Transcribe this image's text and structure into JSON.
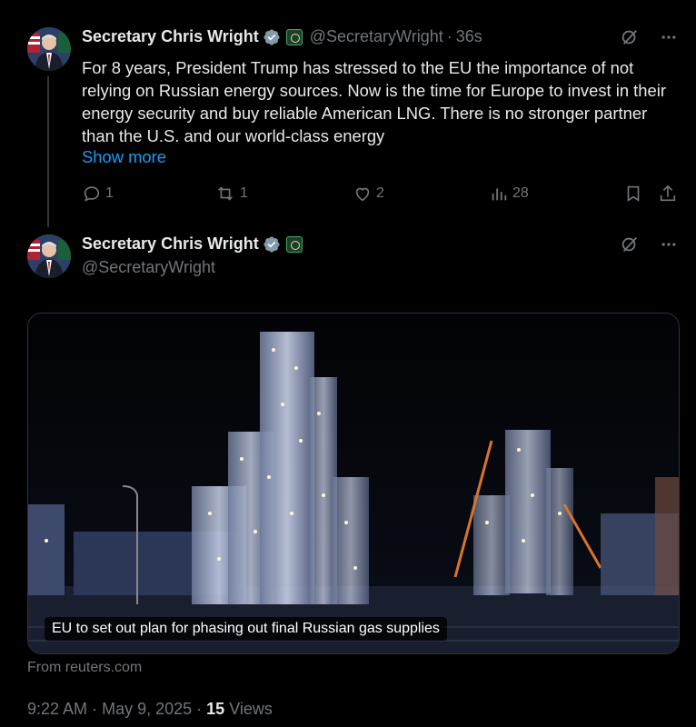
{
  "tweet1": {
    "author_name": "Secretary Chris Wright",
    "handle": "@SecretaryWright",
    "separator": "·",
    "time_ago": "36s",
    "text": "For 8 years, President Trump has stressed to the EU the importance of not relying on Russian energy sources. Now is the time for Europe to invest in their energy security and buy reliable American LNG. There is no stronger partner than the U.S. and our world-class energy",
    "show_more": "Show more",
    "actions": {
      "replies": "1",
      "reposts": "1",
      "likes": "2",
      "views": "28"
    }
  },
  "tweet2": {
    "author_name": "Secretary Chris Wright",
    "handle": "@SecretaryWright",
    "card": {
      "headline": "EU to set out plan for phasing out final Russian gas supplies",
      "source": "From reuters.com"
    },
    "meta": {
      "time": "9:22 AM",
      "dot": "·",
      "date": "May 9, 2025",
      "views_count": "15",
      "views_label": "Views"
    }
  },
  "colors": {
    "background": "#000000",
    "text": "#e7e9ea",
    "muted": "#71767b",
    "link": "#1d9bf0",
    "verified": "#829aab"
  },
  "icons": [
    "verified-badge-icon",
    "gov-seal-icon",
    "grok-icon",
    "more-icon",
    "reply-icon",
    "repost-icon",
    "like-icon",
    "views-icon",
    "bookmark-icon",
    "share-icon"
  ]
}
